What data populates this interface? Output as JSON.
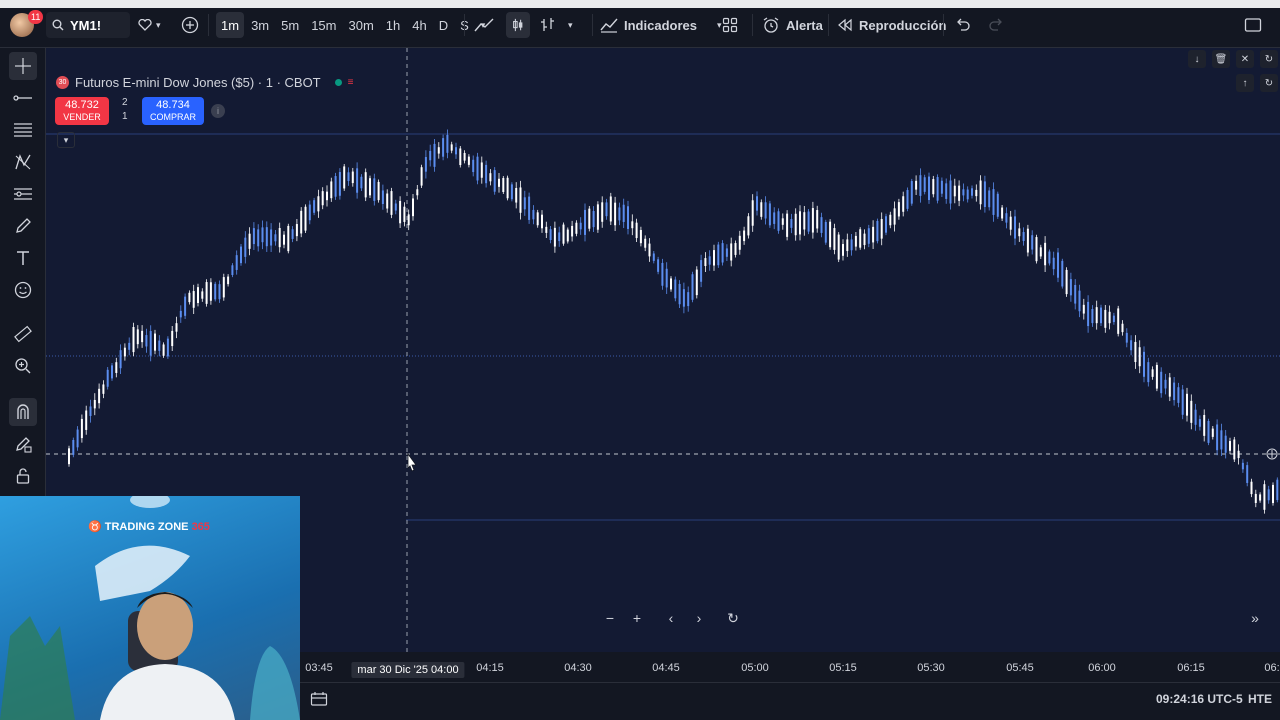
{
  "topbar": {
    "notification_count": "11",
    "symbol": "YM1!",
    "timeframes": [
      "1m",
      "3m",
      "5m",
      "15m",
      "30m",
      "1h",
      "4h",
      "D",
      "S"
    ],
    "active_timeframe": "1m",
    "indicators_label": "Indicadores",
    "alert_label": "Alerta",
    "replay_label": "Reproducción"
  },
  "chart": {
    "title": "Futuros E-mini Dow Jones ($5) · 1 · CBOT",
    "sell_price": "48.732",
    "sell_label": "VENDER",
    "buy_price": "48.734",
    "buy_label": "COMPRAR",
    "spread_top": "2",
    "spread_bottom": "1",
    "symbol_badge": "30"
  },
  "time_axis": {
    "labels": [
      "03:45",
      "04:15",
      "04:30",
      "04:45",
      "05:00",
      "05:15",
      "05:30",
      "05:45",
      "06:00",
      "06:15",
      "06:"
    ],
    "crosshair_label": "mar 30 Dic '25  04:00"
  },
  "bottombar": {
    "clock": "09:24:16 UTC-5",
    "session": "HTE"
  },
  "webcam": {
    "logo_text": "TRADING ZONE",
    "logo_suffix": "365"
  },
  "colors": {
    "background": "#131a33",
    "candle_blue": "#5b8def",
    "candle_white": "#ffffff",
    "sell": "#f23645",
    "buy": "#2962ff"
  }
}
